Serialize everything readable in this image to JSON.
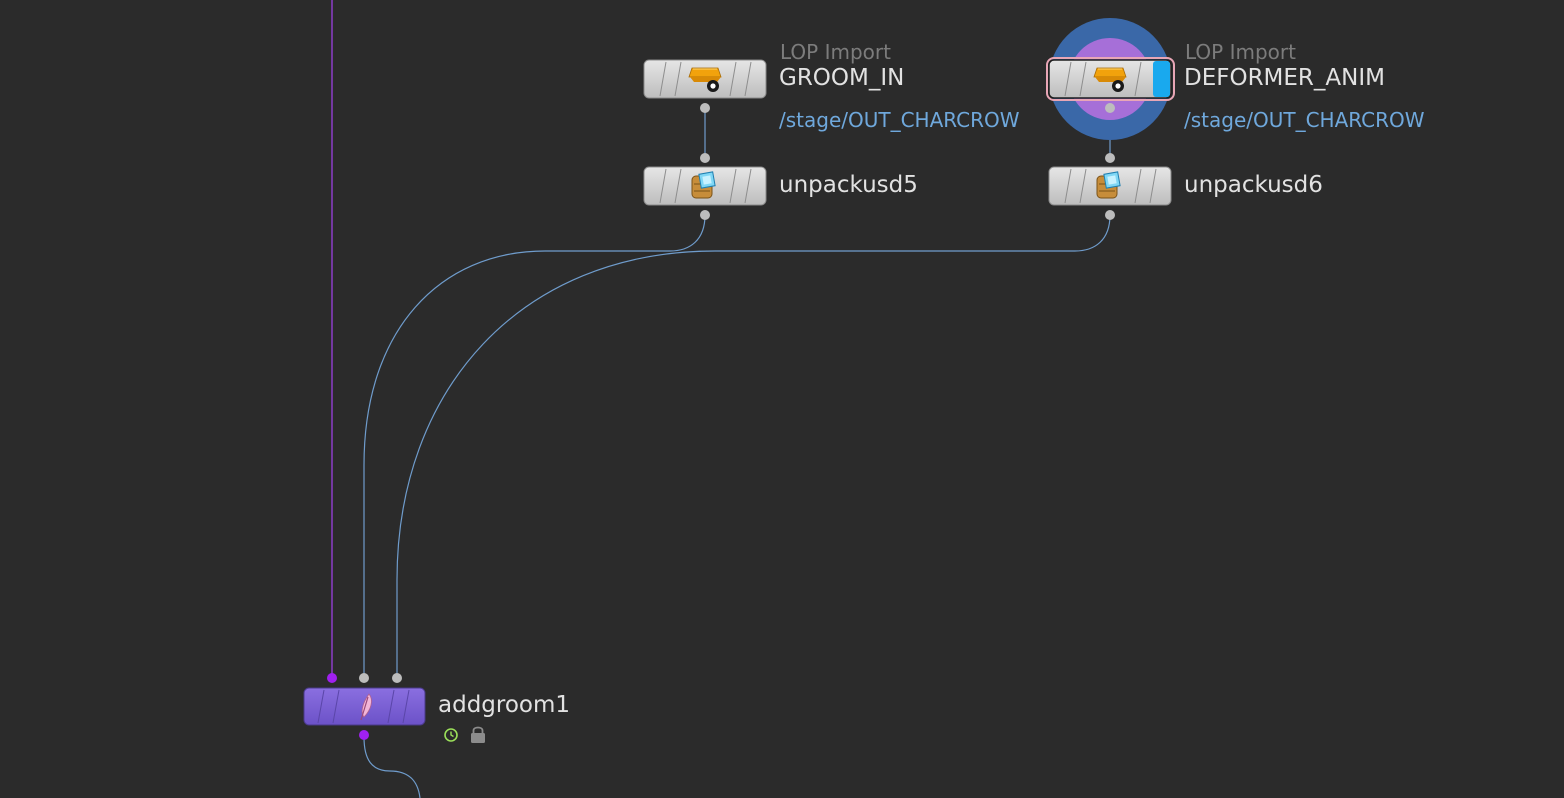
{
  "network": {
    "nodes": {
      "groom_in": {
        "type_label": "LOP Import",
        "name": "GROOM_IN",
        "path": "/stage/OUT_CHARCROW",
        "icon": "lop-import-icon"
      },
      "deformer_anim": {
        "type_label": "LOP Import",
        "name": "DEFORMER_ANIM",
        "path": "/stage/OUT_CHARCROW",
        "icon": "lop-import-icon",
        "selected": true,
        "display_flag": true
      },
      "unpackusd5": {
        "name": "unpackusd5",
        "icon": "unpack-usd-icon"
      },
      "unpackusd6": {
        "name": "unpackusd6",
        "icon": "unpack-usd-icon"
      },
      "addgroom1": {
        "name": "addgroom1",
        "icon": "feather-icon",
        "badges": [
          "time-dependent-icon",
          "lock-icon"
        ]
      }
    }
  },
  "colors": {
    "background": "#2b2b2b",
    "node_gray": "#d2d2d2",
    "node_purple": "#7b5fd6",
    "wire_blue": "#6f9ccc",
    "wire_purple": "#9b3fe0",
    "path_text": "#6fa8dc",
    "display_flag_blue": "#19a9ee",
    "selection_ring_outer": "#3a68a8",
    "selection_ring_inner": "#a66fd8"
  }
}
